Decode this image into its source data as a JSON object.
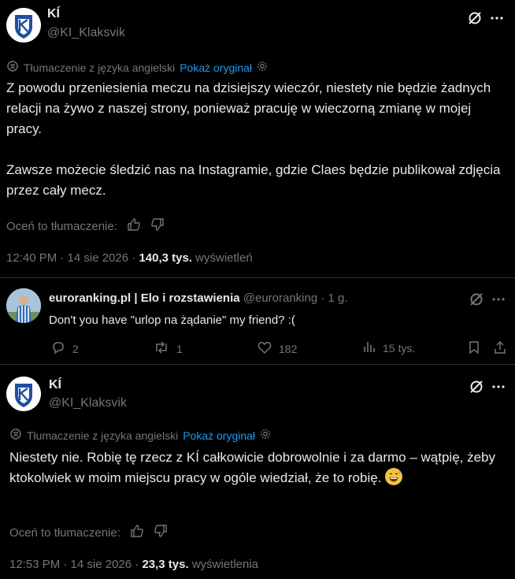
{
  "post1": {
    "name": "KÍ",
    "handle": "@KI_Klaksvik",
    "translation_label": "Tłumaczenie z języka angielski",
    "show_original": "Pokaż oryginał",
    "paragraph1": "Z powodu przeniesienia meczu na dzisiejszy wieczór, niestety nie będzie żadnych relacji na żywo z naszej strony, ponieważ pracuję w wieczorną zmianę w mojej pracy.",
    "paragraph2": "Zawsze możecie śledzić nas na Instagramie, gdzie Claes będzie publikował zdjęcia przez cały mecz.",
    "rate_label": "Oceń to tłumaczenie:",
    "time": "12:40 PM · 14 sie 2026 ·",
    "views_count": "140,3 tys.",
    "views_label": "wyświetleń"
  },
  "reply": {
    "name": "euroranking.pl | Elo i rozstawienia",
    "handle": "@euroranking",
    "age": "· 1 g.",
    "text": "Don't you have \"urlop na żądanie\" my friend? :(",
    "replies": "2",
    "reposts": "1",
    "likes": "182",
    "views": "15 tys."
  },
  "post2": {
    "name": "KÍ",
    "handle": "@KI_Klaksvik",
    "translation_label": "Tłumaczenie z języka angielski",
    "show_original": "Pokaż oryginał",
    "text": "Niestety nie. Robię tę rzecz z KÍ całkowicie dobrowolnie i za darmo – wątpię, żeby ktokolwiek w moim miejscu pracy w ogóle wiedział, że to robię.",
    "rate_label": "Oceń to tłumaczenie:",
    "time": "12:53 PM · 14 sie 2026 ·",
    "views_count": "23,3 tys.",
    "views_label": "wyświetlenia"
  },
  "colors": {
    "background": "#000000",
    "text": "#e7e9ea",
    "muted": "#71767b",
    "link": "#1d9bf0",
    "crest_blue": "#1f4fa0"
  },
  "icons": [
    "grok-icon",
    "more-icon",
    "translate-icon",
    "settings-icon",
    "thumbs-up-icon",
    "thumbs-down-icon",
    "reply-icon",
    "repost-icon",
    "like-icon",
    "views-icon",
    "bookmark-icon",
    "share-icon",
    "grinning-sweat-emoji"
  ]
}
